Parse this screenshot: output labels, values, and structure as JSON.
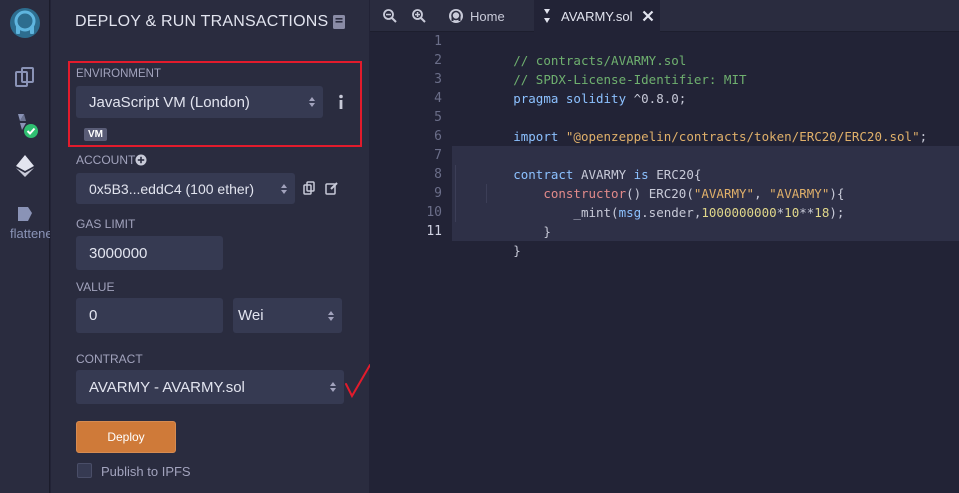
{
  "sidebar": {
    "icons": [
      "remix-logo-icon",
      "file-explorer-icon",
      "solidity-compiler-icon",
      "deploy-run-icon",
      "flattener-icon"
    ],
    "flattener_label": "flattener"
  },
  "panel": {
    "title": "DEPLOY & RUN TRANSACTIONS",
    "environment": {
      "label": "ENVIRONMENT",
      "value": "JavaScript VM (London)",
      "badge": "VM"
    },
    "account": {
      "label": "ACCOUNT",
      "value": "0x5B3...eddC4 (100 ether)"
    },
    "gas_limit": {
      "label": "GAS LIMIT",
      "value": "3000000"
    },
    "value": {
      "label": "VALUE",
      "amount": "0",
      "unit": "Wei"
    },
    "contract": {
      "label": "CONTRACT",
      "value": "AVARMY - AVARMY.sol"
    },
    "deploy_label": "Deploy",
    "publish_label": "Publish to IPFS"
  },
  "editor": {
    "tabs": {
      "home": "Home",
      "file": "AVARMY.sol"
    },
    "line_numbers": [
      "1",
      "2",
      "3",
      "4",
      "5",
      "6",
      "7",
      "8",
      "9",
      "10",
      "11"
    ],
    "lines": [
      [
        "// contracts/AVARMY.sol"
      ],
      [
        "// SPDX-License-Identifier: MIT"
      ],
      [
        "pragma solidity",
        " ^0.8.0;"
      ],
      [
        ""
      ],
      [
        "import ",
        "\"@openzeppelin/contracts/token/ERC20/ERC20.sol\"",
        ";"
      ],
      [
        ""
      ],
      [
        "contract",
        " AVARMY ",
        "is",
        " ERC20{"
      ],
      [
        "    ",
        "constructor",
        "() ERC20(",
        "\"AVARMY\"",
        ", ",
        "\"AVARMY\"",
        "){"
      ],
      [
        "        _mint(",
        "msg",
        ".sender,",
        "1000000000",
        "*",
        "10",
        "**",
        "18",
        ");"
      ],
      [
        "    }"
      ],
      [
        "}"
      ]
    ]
  },
  "colors": {
    "accent": "#cf7a39",
    "highlight_box": "#e21b2c",
    "annotation": "#e21b2c"
  }
}
